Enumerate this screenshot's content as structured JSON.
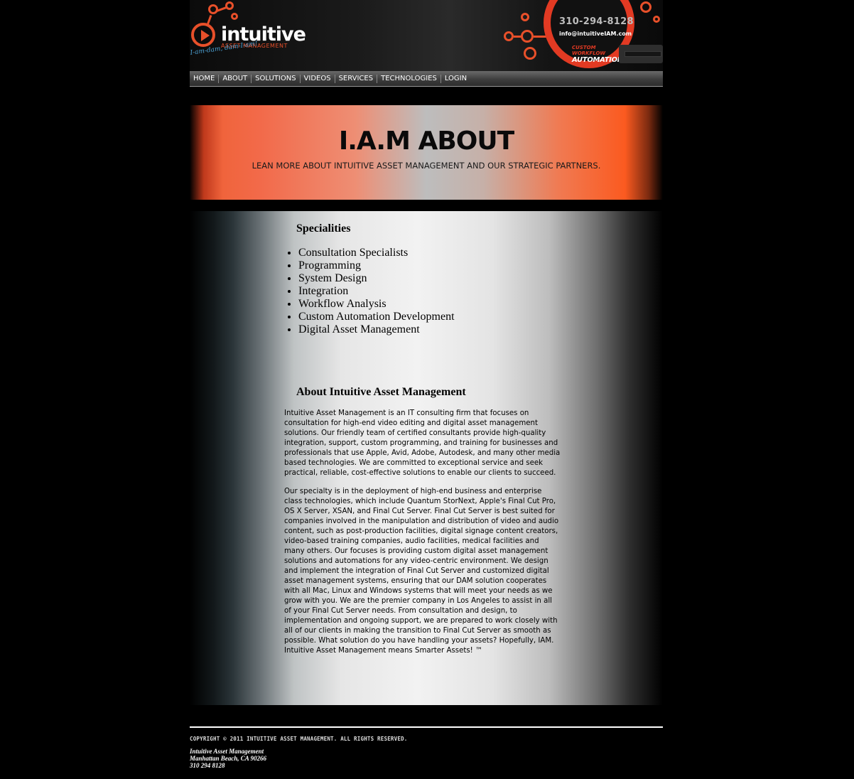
{
  "header": {
    "logo_word": "intuitive",
    "logo_sub": "ASSET MANAGEMENT",
    "logo_tagline": "I-am-dam, dam-I-am!",
    "phone": "310-294-8128",
    "email": "info@intuitiveIAM.com",
    "badge_top": "CUSTOM WORKFLOW",
    "badge_bottom": "AUTOMATION",
    "accent_color": "#e8502a"
  },
  "nav": {
    "items": [
      {
        "label": "HOME"
      },
      {
        "label": "ABOUT"
      },
      {
        "label": "SOLUTIONS"
      },
      {
        "label": "VIDEOS"
      },
      {
        "label": "SERVICES"
      },
      {
        "label": "TECHNOLOGIES"
      },
      {
        "label": "LOGIN"
      }
    ]
  },
  "banner": {
    "title": "I.A.M ABOUT",
    "subtitle": "LEAN MORE ABOUT INTUITIVE ASSET MANAGEMENT AND OUR STRATEGIC PARTNERS."
  },
  "specialities": {
    "title": "Specialities",
    "items": [
      "Consultation Specialists",
      "Programming",
      "System Design",
      "Integration",
      "Workflow Analysis",
      "Custom Automation Development",
      "Digital Asset Management"
    ]
  },
  "about": {
    "title": "About Intuitive Asset Management",
    "paragraph1": "Intuitive Asset Management is an IT consulting firm that focuses on consultation for high-end video editing and digital asset management solutions. Our friendly team of certified consultants provide high-quality integration, support, custom programming, and training for businesses and professionals that use Apple, Avid, Adobe, Autodesk, and many other media based technologies. We are committed to exceptional service and seek practical, reliable, cost-effective solutions to enable our clients to succeed.",
    "paragraph2": "Our specialty is in the deployment of high-end business and enterprise class technologies, which include Quantum StorNext, Apple's Final Cut Pro, OS X Server, XSAN, and Final Cut Server. Final Cut Server is best suited for companies involved in the manipulation and distribution of video and audio content, such as post-production facilities, digital signage content creators, video-based training companies, audio facilities, medical facilities and many others. Our focuses is providing custom digital asset management solutions and automations for any video-centric environment. We design and implement the integration of Final Cut Server and customized digital asset management systems, ensuring that our DAM solution cooperates with all Mac, Linux and Windows systems that will meet your needs as we grow with you. We are the premier company in Los Angeles to assist in all of your Final Cut Server needs. From consultation and design, to implementation and ongoing support, we are prepared to work closely with all of our clients in making the transition to Final Cut Server as smooth as possible. What solution do you have handling your assets? Hopefully, IAM. Intuitive Asset Management means Smarter Assets! ™"
  },
  "footer": {
    "copyright": "COPYRIGHT © 2011 INTUITIVE ASSET MANAGEMENT. ALL RIGHTS RESERVED.",
    "company": "Intuitive Asset Management",
    "city": "Manhattan Beach, CA 90266",
    "phone": "310 294 8128"
  }
}
